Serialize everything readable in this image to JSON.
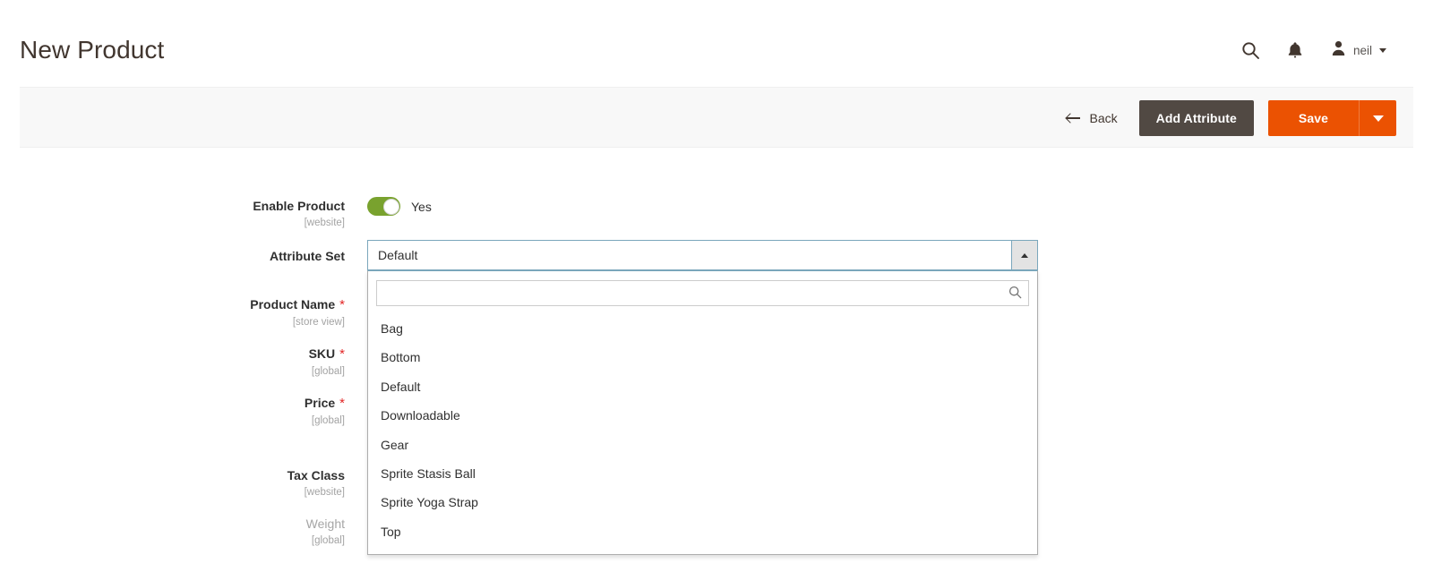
{
  "header": {
    "title": "New Product",
    "search_icon": "search-icon",
    "notifications_icon": "bell-icon",
    "avatar_icon": "user-avatar-icon",
    "user_name": "neil",
    "user_caret": "chevron-down-icon"
  },
  "toolbar": {
    "back_label": "Back",
    "back_icon": "arrow-left-icon",
    "add_attribute_label": "Add Attribute",
    "save_label": "Save",
    "save_caret": "chevron-down-icon",
    "colors": {
      "save_bg": "#eb5202",
      "add_attribute_bg": "#514943",
      "bar_bg": "#f8f8f8"
    }
  },
  "form": {
    "fields": [
      {
        "label": "Enable Product",
        "scope": "[website]",
        "required": false,
        "muted": false,
        "toggle_value": "Yes",
        "toggle_on": true
      },
      {
        "label": "Attribute Set",
        "scope": "",
        "required": false,
        "muted": false,
        "selected_value": "Default"
      },
      {
        "label": "Product Name",
        "scope": "[store view]",
        "required": true,
        "muted": false
      },
      {
        "label": "SKU",
        "scope": "[global]",
        "required": true,
        "muted": false
      },
      {
        "label": "Price",
        "scope": "[global]",
        "required": true,
        "muted": false
      },
      {
        "label": "Tax Class",
        "scope": "[website]",
        "required": false,
        "muted": false
      },
      {
        "label": "Weight",
        "scope": "[global]",
        "required": false,
        "muted": true
      }
    ]
  },
  "attribute_set_dropdown": {
    "open": true,
    "search_value": "",
    "search_placeholder": "",
    "search_icon": "search-icon",
    "options": [
      "Bag",
      "Bottom",
      "Default",
      "Downloadable",
      "Gear",
      "Sprite Stasis Ball",
      "Sprite Yoga Strap",
      "Top"
    ]
  },
  "required_marker": "*"
}
